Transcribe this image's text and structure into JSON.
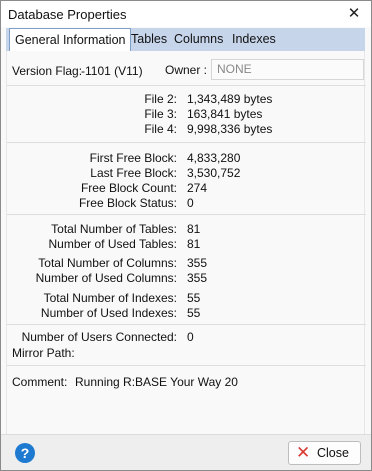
{
  "window": {
    "title": "Database Properties",
    "close_glyph": "✕"
  },
  "tabs": [
    {
      "label": "General Information",
      "active": true
    },
    {
      "label": "Tables"
    },
    {
      "label": "Columns"
    },
    {
      "label": "Indexes"
    }
  ],
  "general": {
    "version_flag_label": "Version Flag:",
    "version_flag_value": "-1101 (V11)",
    "owner_label": "Owner :",
    "owner_value": "NONE",
    "files": [
      {
        "label": "File 2:",
        "value": "1,343,489 bytes"
      },
      {
        "label": "File 3:",
        "value": "163,841 bytes"
      },
      {
        "label": "File 4:",
        "value": "9,998,336 bytes"
      }
    ],
    "blocks": [
      {
        "label": "First Free Block:",
        "value": "4,833,280"
      },
      {
        "label": "Last Free Block:",
        "value": "3,530,752"
      },
      {
        "label": "Free Block Count:",
        "value": "274"
      },
      {
        "label": "Free Block Status:",
        "value": "0"
      }
    ],
    "tables": [
      {
        "label": "Total Number of Tables:",
        "value": "81"
      },
      {
        "label": "Number of Used Tables:",
        "value": "81"
      }
    ],
    "columns": [
      {
        "label": "Total Number of Columns:",
        "value": "355"
      },
      {
        "label": "Number of Used Columns:",
        "value": "355"
      }
    ],
    "indexes": [
      {
        "label": "Total Number of Indexes:",
        "value": "55"
      },
      {
        "label": "Number of Used Indexes:",
        "value": "55"
      }
    ],
    "users_label": "Number of Users Connected:",
    "users_value": "0",
    "mirror_label": "Mirror Path:",
    "mirror_value": "",
    "comment_label": "Comment:",
    "comment_value": "Running R:BASE Your Way 20"
  },
  "footer": {
    "help_glyph": "?",
    "close_label": "Close",
    "close_icon_glyph": "✕"
  },
  "colors": {
    "tabbar": "#c7d5ea",
    "help": "#1e7ad1",
    "close_icon": "#d93a2f"
  },
  "icons": {
    "help": "help-circle-icon",
    "close": "close-x-icon"
  }
}
